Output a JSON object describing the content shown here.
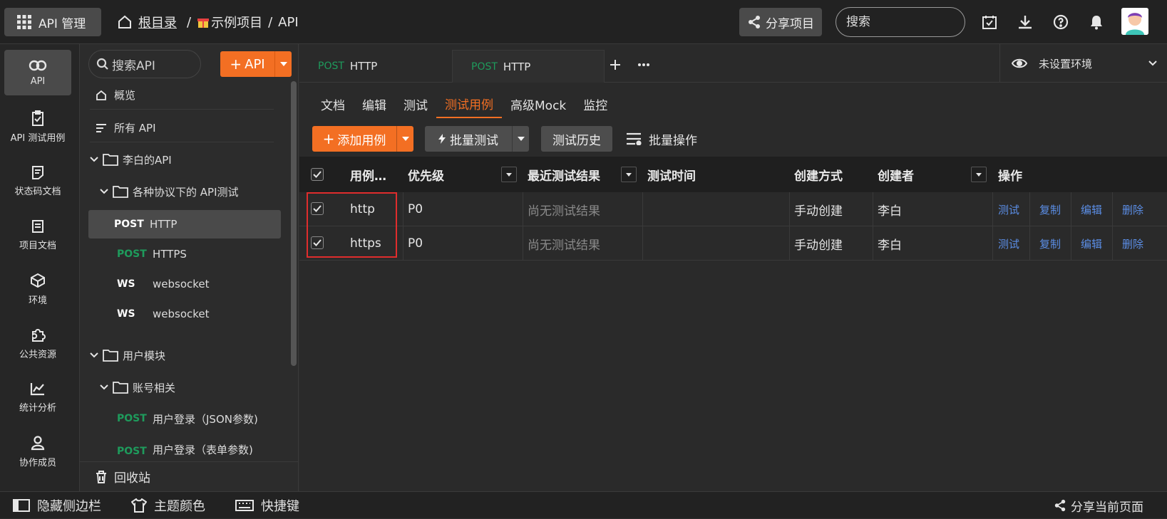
{
  "topbar": {
    "app_label": "API 管理",
    "crumb_root": "根目录",
    "crumb_sep1": "/",
    "crumb_project": "示例项目",
    "crumb_sep2": "/",
    "crumb_api": "API",
    "share_label": "分享项目",
    "search_placeholder": "搜索"
  },
  "rail": {
    "items": [
      {
        "label": "API"
      },
      {
        "label": "API 测试用例"
      },
      {
        "label": "状态码文档"
      },
      {
        "label": "项目文档"
      },
      {
        "label": "环境"
      },
      {
        "label": "公共资源"
      },
      {
        "label": "统计分析"
      },
      {
        "label": "协作成员"
      }
    ]
  },
  "tree": {
    "search_placeholder": "搜索API",
    "add_label": "API",
    "overview": "概览",
    "all_api": "所有 API",
    "folder1": "李白的API",
    "folder1_sub": "各种协议下的 API测试",
    "apis": [
      {
        "method": "POST",
        "name": "HTTP"
      },
      {
        "method": "POST",
        "name": "HTTPS"
      },
      {
        "method": "WS",
        "name": "websocket"
      },
      {
        "method": "WS",
        "name": "websocket"
      }
    ],
    "folder2": "用户模块",
    "folder2_sub": "账号相关",
    "apis2": [
      {
        "method": "POST",
        "name": "用户登录（JSON参数)"
      },
      {
        "method": "POST",
        "name": "用户登录（表单参数)"
      }
    ],
    "recycle": "回收站"
  },
  "main": {
    "file_tabs": [
      {
        "method": "POST",
        "name": "HTTP"
      },
      {
        "method": "POST",
        "name": "HTTP"
      }
    ],
    "env_label": "未设置环境",
    "sub_tabs": [
      "文档",
      "编辑",
      "测试",
      "测试用例",
      "高级Mock",
      "监控"
    ],
    "toolbar": {
      "add_case": "添加用例",
      "batch_test": "批量测试",
      "history": "测试历史",
      "batch_ops": "批量操作"
    },
    "columns": [
      "用例…",
      "优先级",
      "最近测试结果",
      "测试时间",
      "创建方式",
      "创建者",
      "操作"
    ],
    "rows": [
      {
        "name": "http",
        "priority": "P0",
        "result": "尚无测试结果",
        "time": "",
        "method": "手动创建",
        "creator": "李白"
      },
      {
        "name": "https",
        "priority": "P0",
        "result": "尚无测试结果",
        "time": "",
        "method": "手动创建",
        "creator": "李白"
      }
    ],
    "actions": [
      "测试",
      "复制",
      "编辑",
      "删除"
    ]
  },
  "footer": {
    "hide_sidebar": "隐藏侧边栏",
    "theme": "主题颜色",
    "shortcuts": "快捷键",
    "share_page": "分享当前页面"
  },
  "colors": {
    "accent": "#f36f23",
    "post": "#1e9b5c",
    "link": "#5b8ee6",
    "highlight_box": "#e02d2d"
  }
}
